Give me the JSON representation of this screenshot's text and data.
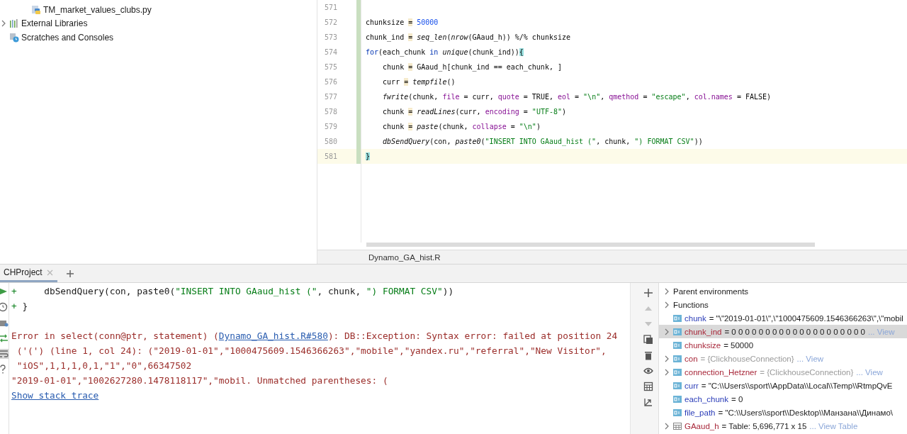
{
  "project_tree": {
    "items": [
      {
        "label": "TM_market_values_clubs.py",
        "kind": "python",
        "indent": true,
        "expandable": false
      },
      {
        "label": "External Libraries",
        "kind": "library",
        "indent": false,
        "expandable": true
      },
      {
        "label": "Scratches and Consoles",
        "kind": "scratches",
        "indent": false,
        "expandable": false
      }
    ]
  },
  "editor": {
    "lines": [
      {
        "number": "571",
        "current": false
      },
      {
        "number": "572",
        "current": false,
        "tokens": [
          {
            "text": "chunksize ",
            "kind": "plain"
          },
          {
            "text": "=",
            "kind": "assign"
          },
          {
            "text": " 50000",
            "kind": "number"
          }
        ]
      },
      {
        "number": "573",
        "current": false,
        "tokens": [
          {
            "text": "chunk_ind ",
            "kind": "plain"
          },
          {
            "text": "=",
            "kind": "assign"
          },
          {
            "text": " seq_len",
            "kind": "call"
          },
          {
            "text": "(",
            "kind": "plain"
          },
          {
            "text": "nrow",
            "kind": "call"
          },
          {
            "text": "(GAaud_h)) %/% chunksize",
            "kind": "plain"
          }
        ]
      },
      {
        "number": "574",
        "current": false,
        "tokens": [
          {
            "text": "for",
            "kind": "keyword"
          },
          {
            "text": "(each_chunk ",
            "kind": "plain"
          },
          {
            "text": "in",
            "kind": "keyword"
          },
          {
            "text": " unique",
            "kind": "call"
          },
          {
            "text": "(chunk_ind))",
            "kind": "plain"
          },
          {
            "text": "{",
            "kind": "brace"
          }
        ]
      },
      {
        "number": "575",
        "current": false,
        "tokens": [
          {
            "text": "    chunk ",
            "kind": "plain"
          },
          {
            "text": "=",
            "kind": "assign"
          },
          {
            "text": " GAaud_h[chunk_ind == each_chunk, ]",
            "kind": "plain"
          }
        ]
      },
      {
        "number": "576",
        "current": false,
        "tokens": [
          {
            "text": "    curr ",
            "kind": "plain"
          },
          {
            "text": "=",
            "kind": "assign"
          },
          {
            "text": " tempfile",
            "kind": "call"
          },
          {
            "text": "()",
            "kind": "plain"
          }
        ]
      },
      {
        "number": "577",
        "current": false,
        "tokens": [
          {
            "text": "    fwrite",
            "kind": "call"
          },
          {
            "text": "(chunk, ",
            "kind": "plain"
          },
          {
            "text": "file",
            "kind": "param"
          },
          {
            "text": " = curr, ",
            "kind": "plain"
          },
          {
            "text": "quote",
            "kind": "param"
          },
          {
            "text": " = TRUE, ",
            "kind": "plain"
          },
          {
            "text": "eol",
            "kind": "param"
          },
          {
            "text": " = ",
            "kind": "plain"
          },
          {
            "text": "\"\\n\"",
            "kind": "string"
          },
          {
            "text": ", ",
            "kind": "plain"
          },
          {
            "text": "qmethod",
            "kind": "param"
          },
          {
            "text": " = ",
            "kind": "plain"
          },
          {
            "text": "\"escape\"",
            "kind": "string"
          },
          {
            "text": ", ",
            "kind": "plain"
          },
          {
            "text": "col.names",
            "kind": "param"
          },
          {
            "text": " = FALSE)",
            "kind": "plain"
          }
        ]
      },
      {
        "number": "578",
        "current": false,
        "tokens": [
          {
            "text": "    chunk ",
            "kind": "plain"
          },
          {
            "text": "=",
            "kind": "assign"
          },
          {
            "text": " readLines",
            "kind": "call"
          },
          {
            "text": "(curr, ",
            "kind": "plain"
          },
          {
            "text": "encoding",
            "kind": "param"
          },
          {
            "text": " = ",
            "kind": "plain"
          },
          {
            "text": "\"UTF-8\"",
            "kind": "string"
          },
          {
            "text": ")",
            "kind": "plain"
          }
        ]
      },
      {
        "number": "579",
        "current": false,
        "tokens": [
          {
            "text": "    chunk ",
            "kind": "plain"
          },
          {
            "text": "=",
            "kind": "assign"
          },
          {
            "text": " paste",
            "kind": "call"
          },
          {
            "text": "(chunk, ",
            "kind": "plain"
          },
          {
            "text": "collapse",
            "kind": "param"
          },
          {
            "text": " = ",
            "kind": "plain"
          },
          {
            "text": "\"\\n\"",
            "kind": "string"
          },
          {
            "text": ")",
            "kind": "plain"
          }
        ]
      },
      {
        "number": "580",
        "current": false,
        "tokens": [
          {
            "text": "    dbSendQuery",
            "kind": "call"
          },
          {
            "text": "(con, ",
            "kind": "plain"
          },
          {
            "text": "paste0",
            "kind": "call"
          },
          {
            "text": "(",
            "kind": "plain"
          },
          {
            "text": "\"INSERT INTO GAaud_hist (\"",
            "kind": "string"
          },
          {
            "text": ", chunk, ",
            "kind": "plain"
          },
          {
            "text": "\") FORMAT CSV\"",
            "kind": "string"
          },
          {
            "text": "))",
            "kind": "plain"
          }
        ]
      },
      {
        "number": "581",
        "current": true,
        "tokens": [
          {
            "text": "}",
            "kind": "brace"
          }
        ]
      }
    ],
    "file_tab": "Dynamo_GA_hist.R"
  },
  "console": {
    "tabs": [
      {
        "label": "CHProject",
        "selected": true
      }
    ],
    "input_lines": [
      {
        "tokens": [
          {
            "text": "+",
            "kind": "prompt"
          },
          {
            "text": "     dbSendQuery(con, paste0(",
            "kind": "plain"
          },
          {
            "text": "\"INSERT INTO GAaud_hist (\"",
            "kind": "string"
          },
          {
            "text": ", chunk, ",
            "kind": "plain"
          },
          {
            "text": "\") FORMAT CSV\"",
            "kind": "string"
          },
          {
            "text": "))",
            "kind": "plain"
          }
        ]
      },
      {
        "tokens": [
          {
            "text": "+",
            "kind": "prompt"
          },
          {
            "text": " }",
            "kind": "plain"
          }
        ]
      }
    ],
    "error": {
      "before": "Error in select(conn@ptr, statement) (",
      "link": "Dynamo_GA_hist.R#580",
      "after": "): DB::Exception: Syntax error: failed at position 24",
      "continuation": [
        " ('(') (line 1, col 24): (\"2019-01-01\",\"1000475609.1546366263\",\"mobile\",\"yandex.ru\",\"referral\",\"New Visitor\",",
        " \"iOS\",1,1,1,0,1,\"1\",\"0\",66347502",
        "\"2019-01-01\",\"1002627280.1478118117\",\"mobil. Unmatched parentheses: ("
      ]
    },
    "stack_trace_link": "Show stack trace"
  },
  "variables": [
    {
      "kind": "group",
      "name": "Parent environments",
      "expandable": true,
      "selected": false
    },
    {
      "kind": "group",
      "name": "Functions",
      "expandable": true,
      "selected": false
    },
    {
      "kind": "value",
      "name": "chunk",
      "color": "#2b3db8",
      "value": "= \"\\\"2019-01-01\\\",\\\"1000475609.1546366263\\\",\\\"mobil",
      "dim": false,
      "expandable": false,
      "selected": false
    },
    {
      "kind": "value",
      "name": "chunk_ind",
      "color": "#a8283a",
      "value": "= 0 0 0 0 0 0 0 0 0 0 0 0 0 0 0 0 0 0 0 0",
      "dim": false,
      "link": "... View",
      "expandable": true,
      "selected": true
    },
    {
      "kind": "value",
      "name": "chunksize",
      "color": "#a8283a",
      "value": "= 50000",
      "dim": false,
      "expandable": false,
      "selected": false
    },
    {
      "kind": "value",
      "name": "con",
      "color": "#a8283a",
      "value": "= {ClickhouseConnection}",
      "dim": true,
      "link": "... View",
      "expandable": true,
      "selected": false
    },
    {
      "kind": "value",
      "name": "connection_Hetzner",
      "color": "#a8283a",
      "value": "= {ClickhouseConnection}",
      "dim": true,
      "link": "... View",
      "expandable": true,
      "selected": false
    },
    {
      "kind": "value",
      "name": "curr",
      "color": "#2b3db8",
      "value": "= \"C:\\\\Users\\\\sport\\\\AppData\\\\Local\\\\Temp\\\\RtmpQvE",
      "dim": false,
      "expandable": false,
      "selected": false
    },
    {
      "kind": "value",
      "name": "each_chunk",
      "color": "#2b3db8",
      "value": "= 0",
      "dim": false,
      "expandable": false,
      "selected": false
    },
    {
      "kind": "value",
      "name": "file_path",
      "color": "#2b3db8",
      "value": "= \"C:\\\\Users\\\\sport\\\\Desktop\\\\Манзана\\\\Динамо\\",
      "dim": false,
      "expandable": false,
      "selected": false
    },
    {
      "kind": "table",
      "name": "GAaud_h",
      "color": "#a8283a",
      "value": "= Table: 5,696,771 x 15",
      "dim": false,
      "link": "... View Table",
      "expandable": true,
      "selected": false
    }
  ]
}
